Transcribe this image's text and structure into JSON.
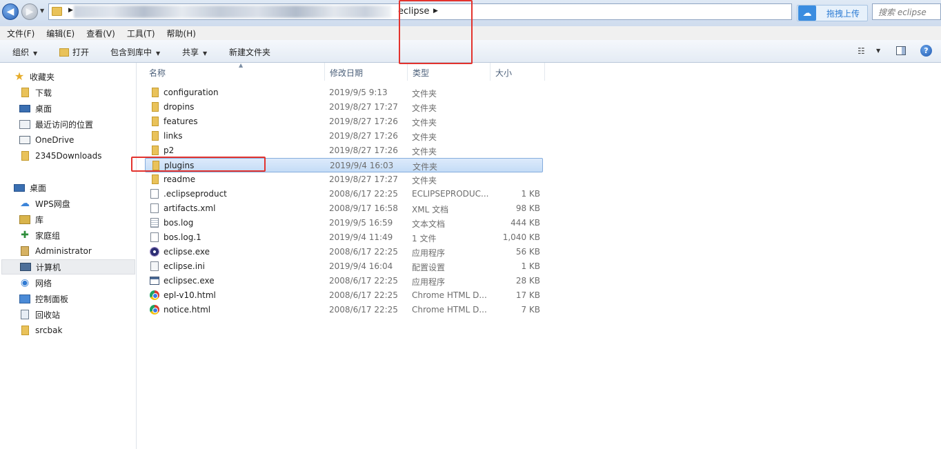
{
  "address_bar": {
    "current_folder": "eclipse",
    "upload_label": "拖拽上传",
    "search_placeholder": "搜索 eclipse"
  },
  "menu": [
    "文件(F)",
    "编辑(E)",
    "查看(V)",
    "工具(T)",
    "帮助(H)"
  ],
  "toolbar": {
    "organize": "组织",
    "open": "打开",
    "include_in_library": "包含到库中",
    "share": "共享",
    "new_folder": "新建文件夹"
  },
  "sidebar": {
    "favorites": [
      {
        "label": "收藏夹",
        "icon": "star-icon"
      },
      {
        "label": "下载",
        "icon": "folder-icon"
      },
      {
        "label": "桌面",
        "icon": "desktop-icon"
      },
      {
        "label": "最近访问的位置",
        "icon": "recent-places-icon"
      },
      {
        "label": "OneDrive",
        "icon": "onedrive-icon"
      },
      {
        "label": "2345Downloads",
        "icon": "folder-icon"
      }
    ],
    "desktop": [
      {
        "label": "桌面",
        "icon": "desktop-icon"
      },
      {
        "label": "WPS网盘",
        "icon": "cloud-icon"
      },
      {
        "label": "库",
        "icon": "library-icon"
      },
      {
        "label": "家庭组",
        "icon": "homegroup-icon"
      },
      {
        "label": "Administrator",
        "icon": "user-folder-icon"
      },
      {
        "label": "计算机",
        "icon": "computer-icon",
        "selected": true
      },
      {
        "label": "网络",
        "icon": "network-icon"
      },
      {
        "label": "控制面板",
        "icon": "control-panel-icon"
      },
      {
        "label": "回收站",
        "icon": "recycle-bin-icon"
      },
      {
        "label": "srcbak",
        "icon": "folder-icon"
      }
    ]
  },
  "columns": {
    "name": "名称",
    "modified": "修改日期",
    "type": "类型",
    "size": "大小"
  },
  "files": [
    {
      "name": "configuration",
      "modified": "2019/9/5 9:13",
      "type": "文件夹",
      "size": "",
      "icon": "folder-icon"
    },
    {
      "name": "dropins",
      "modified": "2019/8/27 17:27",
      "type": "文件夹",
      "size": "",
      "icon": "folder-icon"
    },
    {
      "name": "features",
      "modified": "2019/8/27 17:26",
      "type": "文件夹",
      "size": "",
      "icon": "folder-icon"
    },
    {
      "name": "links",
      "modified": "2019/8/27 17:26",
      "type": "文件夹",
      "size": "",
      "icon": "folder-icon"
    },
    {
      "name": "p2",
      "modified": "2019/8/27 17:26",
      "type": "文件夹",
      "size": "",
      "icon": "folder-icon"
    },
    {
      "name": "plugins",
      "modified": "2019/9/4 16:03",
      "type": "文件夹",
      "size": "",
      "icon": "folder-icon",
      "selected": true
    },
    {
      "name": "readme",
      "modified": "2019/8/27 17:27",
      "type": "文件夹",
      "size": "",
      "icon": "folder-icon"
    },
    {
      "name": ".eclipseproduct",
      "modified": "2008/6/17 22:25",
      "type": "ECLIPSEPRODUC...",
      "size": "1 KB",
      "icon": "file-icon"
    },
    {
      "name": "artifacts.xml",
      "modified": "2008/9/17 16:58",
      "type": "XML 文档",
      "size": "98 KB",
      "icon": "file-icon"
    },
    {
      "name": "bos.log",
      "modified": "2019/9/5 16:59",
      "type": "文本文档",
      "size": "444 KB",
      "icon": "text-file-icon"
    },
    {
      "name": "bos.log.1",
      "modified": "2019/9/4 11:49",
      "type": "1 文件",
      "size": "1,040 KB",
      "icon": "file-icon"
    },
    {
      "name": "eclipse.exe",
      "modified": "2008/6/17 22:25",
      "type": "应用程序",
      "size": "56 KB",
      "icon": "eclipse-icon"
    },
    {
      "name": "eclipse.ini",
      "modified": "2019/9/4 16:04",
      "type": "配置设置",
      "size": "1 KB",
      "icon": "settings-file-icon"
    },
    {
      "name": "eclipsec.exe",
      "modified": "2008/6/17 22:25",
      "type": "应用程序",
      "size": "28 KB",
      "icon": "app-window-icon"
    },
    {
      "name": "epl-v10.html",
      "modified": "2008/6/17 22:25",
      "type": "Chrome HTML D...",
      "size": "17 KB",
      "icon": "chrome-icon"
    },
    {
      "name": "notice.html",
      "modified": "2008/6/17 22:25",
      "type": "Chrome HTML D...",
      "size": "7 KB",
      "icon": "chrome-icon"
    }
  ],
  "colors": {
    "annotation": "#e3322d",
    "selection": "#c4dcf6",
    "accent": "#2c7bd3"
  }
}
